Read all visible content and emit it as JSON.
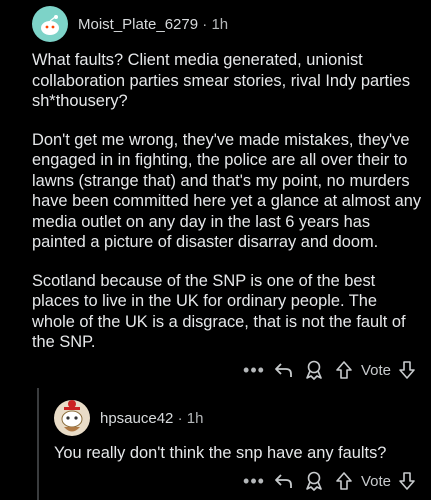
{
  "comment": {
    "username": "Moist_Plate_6279",
    "separator": "·",
    "time": "1h",
    "paragraphs": [
      "What faults? Client media generated, unionist collaboration parties smear stories, rival Indy parties sh*thousery?",
      "Don't get me wrong, they've made mistakes, they've engaged in in fighting, the police are all over their to lawns (strange that) and that's my point, no murders have been committed here yet a glance at almost any media outlet on any day in the last 6 years has painted a picture of disaster disarray and doom.",
      "Scotland because of the SNP is one of the best places to live in the UK for ordinary people. The whole of the UK is a disgrace, that is not the fault of the SNP."
    ],
    "actions": {
      "more": "•••",
      "vote_label": "Vote"
    }
  },
  "reply": {
    "username": "hpsauce42",
    "separator": "·",
    "time": "1h",
    "text": "You really don't think the snp have any faults?",
    "actions": {
      "more": "•••",
      "vote_label": "Vote"
    }
  },
  "colors": {
    "background": "#000000",
    "text": "#e6e8ea",
    "meta": "#b5b8ba",
    "avatar_1": "#7dd3c8",
    "avatar_2": "#e9dcc7"
  }
}
